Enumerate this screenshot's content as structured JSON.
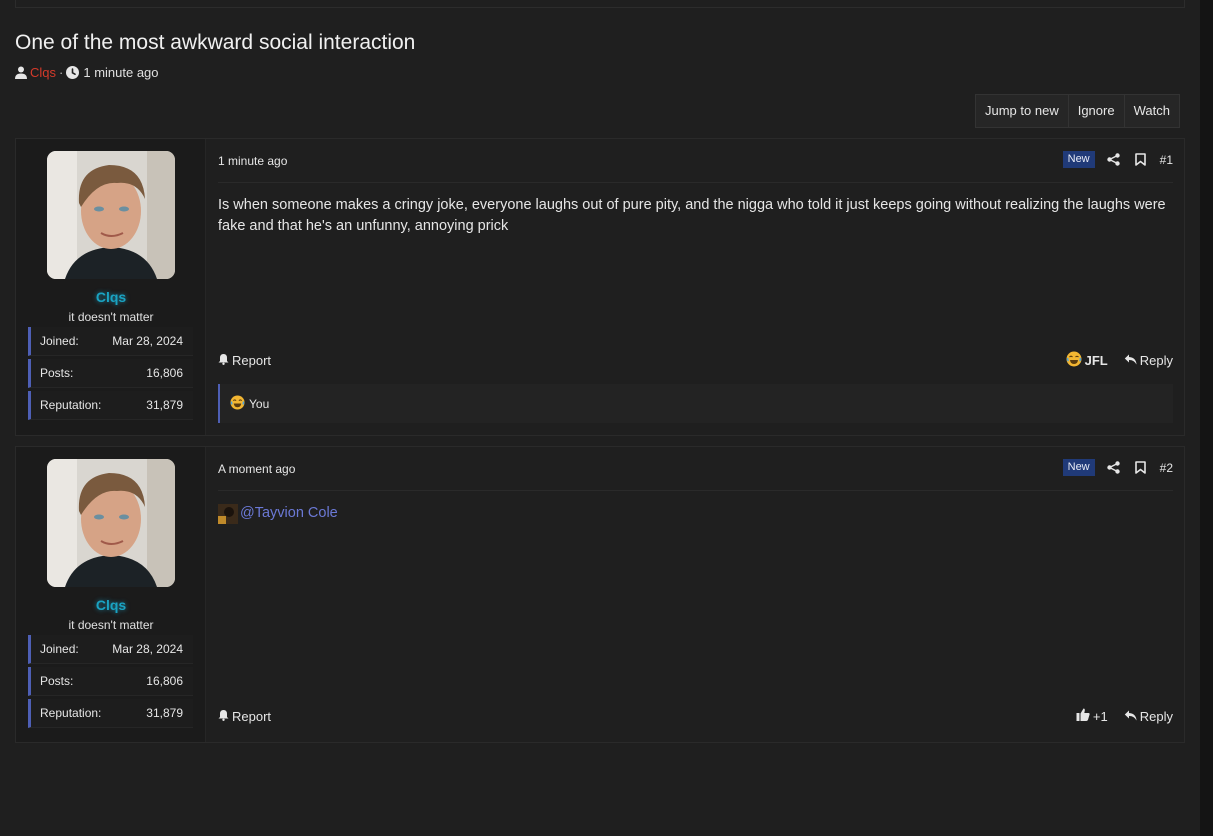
{
  "thread": {
    "title": "One of the most awkward social interaction",
    "author": "Clqs",
    "separator": "·",
    "time": "1 minute ago"
  },
  "actions": {
    "jump_to_new": "Jump to new",
    "ignore": "Ignore",
    "watch": "Watch"
  },
  "colors": {
    "accent": "#4e5fb5",
    "username": "#1aa3c2",
    "author_link": "#d43a2a",
    "new_badge": "#203a78",
    "mention": "#6b79d6"
  },
  "posts": [
    {
      "user": {
        "name": "Clqs",
        "title": "it doesn't matter",
        "joined_label": "Joined:",
        "joined": "Mar 28, 2024",
        "posts_label": "Posts:",
        "posts": "16,806",
        "reputation_label": "Reputation:",
        "reputation": "31,879"
      },
      "date": "1 minute ago",
      "badge": "New",
      "number": "#1",
      "body": "Is when someone makes a cringy joke, everyone laughs out of pure pity, and the nigga who told it just keeps going without realizing the laughs were fake and that he's an unfunny, annoying prick",
      "report": "Report",
      "reaction_label": "JFL",
      "reply": "Reply",
      "reactions_by": "You"
    },
    {
      "user": {
        "name": "Clqs",
        "title": "it doesn't matter",
        "joined_label": "Joined:",
        "joined": "Mar 28, 2024",
        "posts_label": "Posts:",
        "posts": "16,806",
        "reputation_label": "Reputation:",
        "reputation": "31,879"
      },
      "date": "A moment ago",
      "badge": "New",
      "number": "#2",
      "mention": "@Tayvion Cole",
      "report": "Report",
      "reaction_label": "+1",
      "reply": "Reply"
    }
  ]
}
